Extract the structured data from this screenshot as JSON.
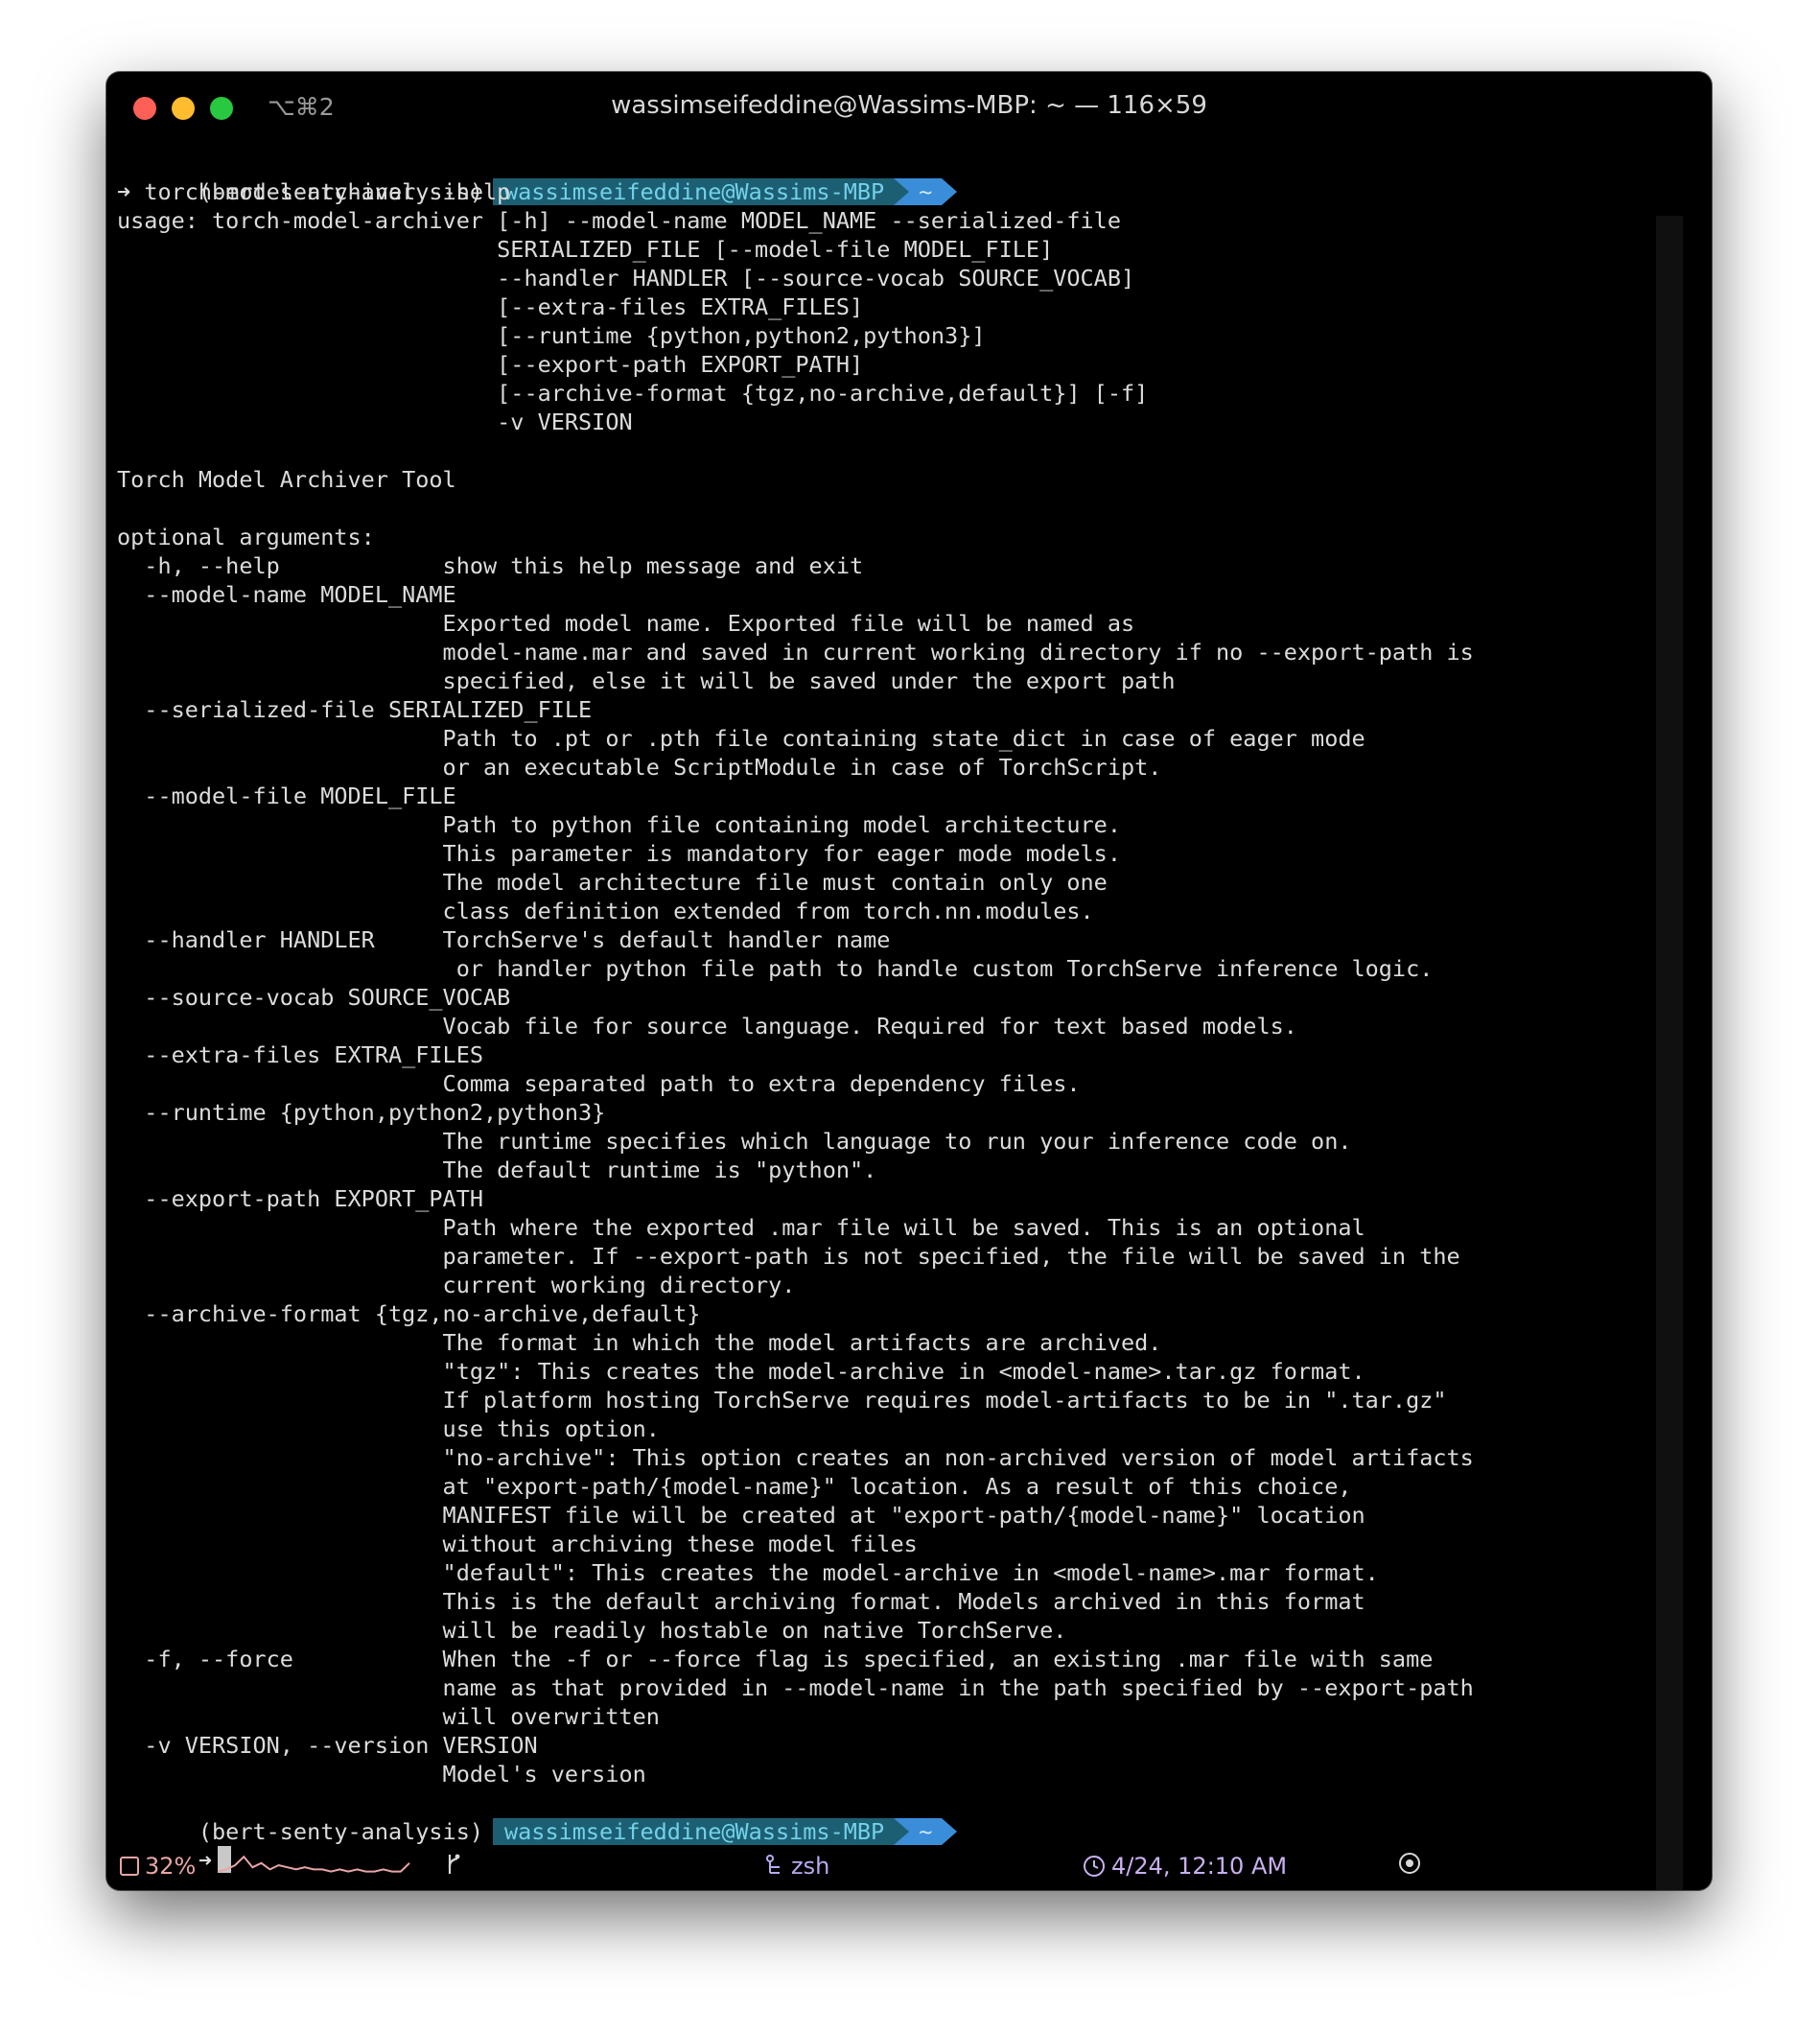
{
  "window": {
    "shortcut": "⌥⌘2",
    "title": "wassimseifeddine@Wassims-MBP: ~ — 116×59"
  },
  "prompt": {
    "env": "(bert-senty-analysis)",
    "user_host": "wassimseifeddine@Wassims-MBP",
    "dir": "~",
    "arrow": "➜"
  },
  "command": "torch-model-archiver --help",
  "output_lines": [
    "usage: torch-model-archiver [-h] --model-name MODEL_NAME --serialized-file",
    "                            SERIALIZED_FILE [--model-file MODEL_FILE]",
    "                            --handler HANDLER [--source-vocab SOURCE_VOCAB]",
    "                            [--extra-files EXTRA_FILES]",
    "                            [--runtime {python,python2,python3}]",
    "                            [--export-path EXPORT_PATH]",
    "                            [--archive-format {tgz,no-archive,default}] [-f]",
    "                            -v VERSION",
    "",
    "Torch Model Archiver Tool",
    "",
    "optional arguments:",
    "  -h, --help            show this help message and exit",
    "  --model-name MODEL_NAME",
    "                        Exported model name. Exported file will be named as",
    "                        model-name.mar and saved in current working directory if no --export-path is",
    "                        specified, else it will be saved under the export path",
    "  --serialized-file SERIALIZED_FILE",
    "                        Path to .pt or .pth file containing state_dict in case of eager mode",
    "                        or an executable ScriptModule in case of TorchScript.",
    "  --model-file MODEL_FILE",
    "                        Path to python file containing model architecture.",
    "                        This parameter is mandatory for eager mode models.",
    "                        The model architecture file must contain only one",
    "                        class definition extended from torch.nn.modules.",
    "  --handler HANDLER     TorchServe's default handler name",
    "                         or handler python file path to handle custom TorchServe inference logic.",
    "  --source-vocab SOURCE_VOCAB",
    "                        Vocab file for source language. Required for text based models.",
    "  --extra-files EXTRA_FILES",
    "                        Comma separated path to extra dependency files.",
    "  --runtime {python,python2,python3}",
    "                        The runtime specifies which language to run your inference code on.",
    "                        The default runtime is \"python\".",
    "  --export-path EXPORT_PATH",
    "                        Path where the exported .mar file will be saved. This is an optional",
    "                        parameter. If --export-path is not specified, the file will be saved in the",
    "                        current working directory.",
    "  --archive-format {tgz,no-archive,default}",
    "                        The format in which the model artifacts are archived.",
    "                        \"tgz\": This creates the model-archive in <model-name>.tar.gz format.",
    "                        If platform hosting TorchServe requires model-artifacts to be in \".tar.gz\"",
    "                        use this option.",
    "                        \"no-archive\": This option creates an non-archived version of model artifacts",
    "                        at \"export-path/{model-name}\" location. As a result of this choice,",
    "                        MANIFEST file will be created at \"export-path/{model-name}\" location",
    "                        without archiving these model files",
    "                        \"default\": This creates the model-archive in <model-name>.mar format.",
    "                        This is the default archiving format. Models archived in this format",
    "                        will be readily hostable on native TorchServe.",
    "  -f, --force           When the -f or --force flag is specified, an existing .mar file with same",
    "                        name as that provided in --model-name in the path specified by --export-path",
    "                        will overwritten",
    "  -v VERSION, --version VERSION",
    "                        Model's version"
  ],
  "statusbar": {
    "cpu": "32%",
    "shell": "zsh",
    "datetime": "4/24, 12:10 AM",
    "cpu_icon": "cpu-icon",
    "branch_icon": "git-branch-icon",
    "shell_icon": "process-icon",
    "clock_icon": "clock-icon",
    "circle_icon": "target-icon",
    "sparkline": [
      2,
      3,
      5,
      9,
      4,
      6,
      3,
      5,
      4,
      3,
      4,
      3,
      3,
      2,
      3,
      2,
      3,
      2,
      2,
      3,
      2,
      2,
      6
    ]
  },
  "colors": {
    "background": "#000000",
    "text": "#dcdcdc",
    "prompt_user_bg": "#1c5f73",
    "prompt_dir_bg": "#3a8dd9",
    "cpu": "#e8a5a5",
    "time": "#c9b0f0"
  }
}
